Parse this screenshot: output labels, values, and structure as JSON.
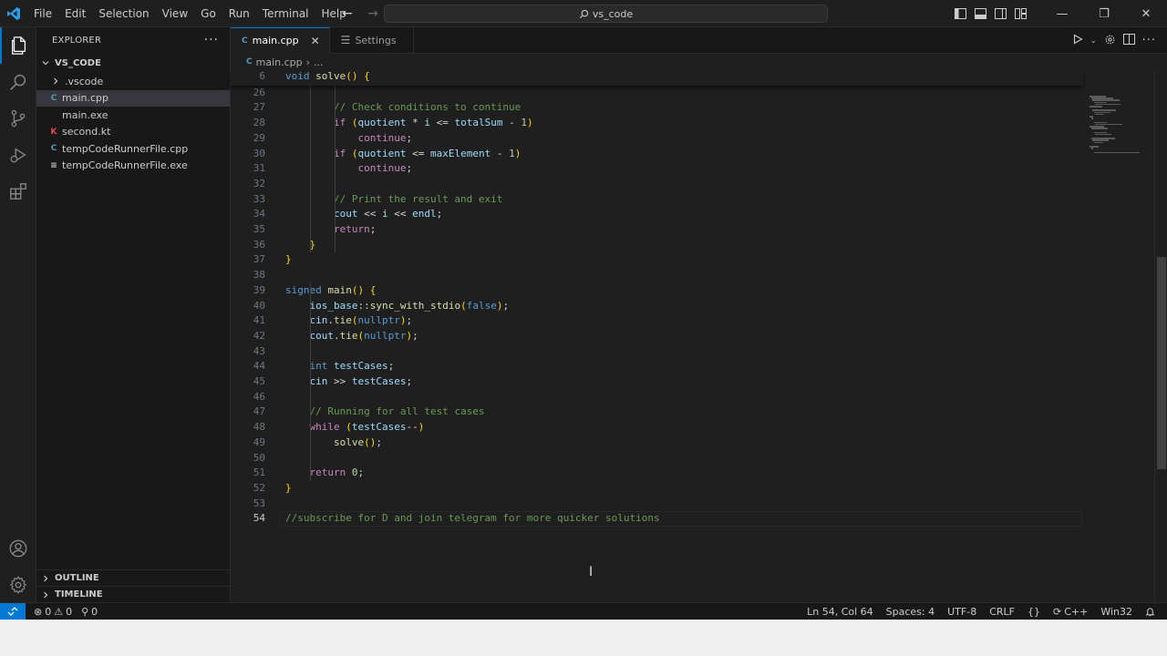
{
  "titlebar": {
    "menu": [
      "File",
      "Edit",
      "Selection",
      "View",
      "Go",
      "Run",
      "Terminal",
      "Help"
    ],
    "search_text": "vs_code"
  },
  "sidebar": {
    "title": "EXPLORER",
    "folder": "VS_CODE",
    "items": [
      {
        "label": ".vscode",
        "kind": "folder"
      },
      {
        "label": "main.cpp",
        "kind": "cpp",
        "selected": true
      },
      {
        "label": "main.exe",
        "kind": "exe"
      },
      {
        "label": "second.kt",
        "kind": "kotlin"
      },
      {
        "label": "tempCodeRunnerFile.cpp",
        "kind": "cpp"
      },
      {
        "label": "tempCodeRunnerFile.exe",
        "kind": "exe"
      }
    ],
    "outline": "OUTLINE",
    "timeline": "TIMELINE"
  },
  "tabs": [
    {
      "label": "main.cpp",
      "active": true
    },
    {
      "label": "Settings",
      "active": false
    }
  ],
  "breadcrumb": {
    "file": "main.cpp",
    "rest": "..."
  },
  "editor": {
    "sticky_line": {
      "num": "6",
      "code": "void solve() {"
    },
    "lines": [
      {
        "num": "26",
        "code": ""
      },
      {
        "num": "27",
        "code": "        // Check conditions to continue"
      },
      {
        "num": "28",
        "code": "        if (quotient * i <= totalSum - 1)"
      },
      {
        "num": "29",
        "code": "            continue;"
      },
      {
        "num": "30",
        "code": "        if (quotient <= maxElement - 1)"
      },
      {
        "num": "31",
        "code": "            continue;"
      },
      {
        "num": "32",
        "code": ""
      },
      {
        "num": "33",
        "code": "        // Print the result and exit"
      },
      {
        "num": "34",
        "code": "        cout << i << endl;"
      },
      {
        "num": "35",
        "code": "        return;"
      },
      {
        "num": "36",
        "code": "    }"
      },
      {
        "num": "37",
        "code": "}"
      },
      {
        "num": "38",
        "code": ""
      },
      {
        "num": "39",
        "code": "signed main() {"
      },
      {
        "num": "40",
        "code": "    ios_base::sync_with_stdio(false);"
      },
      {
        "num": "41",
        "code": "    cin.tie(nullptr);"
      },
      {
        "num": "42",
        "code": "    cout.tie(nullptr);"
      },
      {
        "num": "43",
        "code": ""
      },
      {
        "num": "44",
        "code": "    int testCases;"
      },
      {
        "num": "45",
        "code": "    cin >> testCases;"
      },
      {
        "num": "46",
        "code": ""
      },
      {
        "num": "47",
        "code": "    // Running for all test cases"
      },
      {
        "num": "48",
        "code": "    while (testCases--)"
      },
      {
        "num": "49",
        "code": "        solve();"
      },
      {
        "num": "50",
        "code": ""
      },
      {
        "num": "51",
        "code": "    return 0;"
      },
      {
        "num": "52",
        "code": "}"
      },
      {
        "num": "53",
        "code": ""
      },
      {
        "num": "54",
        "code": "//subscribe for D and join telegram for more quicker solutions",
        "current": true
      }
    ]
  },
  "statusbar": {
    "errors": "0",
    "warnings": "0",
    "ports": "0",
    "position": "Ln 54, Col 64",
    "spaces": "Spaces: 4",
    "encoding": "UTF-8",
    "eol": "CRLF",
    "language": "C++",
    "platform": "Win32"
  },
  "colors": {
    "accent": "#0078d4",
    "editor_bg": "#1f1f1f",
    "sidebar_bg": "#181818"
  }
}
